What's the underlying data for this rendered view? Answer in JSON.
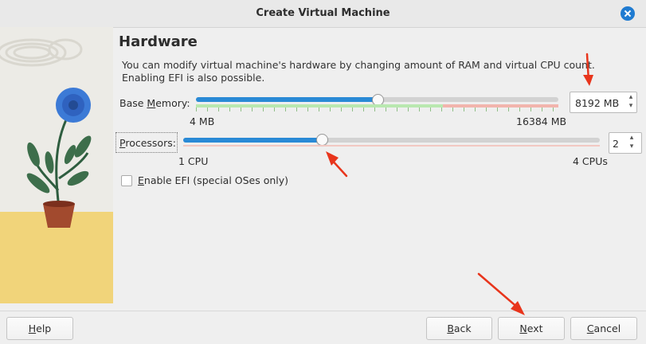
{
  "window": {
    "title": "Create Virtual Machine"
  },
  "page": {
    "heading": "Hardware",
    "description_line1": "You can modify virtual machine's hardware by changing amount of RAM and virtual CPU count.",
    "description_line2": "Enabling EFI is also possible."
  },
  "memory": {
    "label_pre": "Base ",
    "label_mnemonic": "M",
    "label_post": "emory:",
    "min_label": "4 MB",
    "max_label": "16384 MB",
    "value_text": "8192 MB",
    "fraction": 0.5
  },
  "processors": {
    "label_mnemonic": "P",
    "label_post": "rocessors:",
    "min_label": "1 CPU",
    "max_label": "4 CPUs",
    "value_text": "2",
    "fraction": 0.333
  },
  "efi": {
    "label_pre": "",
    "label_mnemonic": "E",
    "label_post": "nable EFI (special OSes only)",
    "checked": false
  },
  "buttons": {
    "help_mnemonic": "H",
    "help_rest": "elp",
    "back_mnemonic": "B",
    "back_rest": "ack",
    "next_mnemonic": "N",
    "next_rest": "ext",
    "cancel_mnemonic": "C",
    "cancel_rest": "ancel"
  },
  "colors": {
    "accent": "#2a8ad6",
    "annotation_arrow": "#e8351c",
    "scale_green": "#b9e8b0",
    "scale_red": "#f2b5ad"
  }
}
